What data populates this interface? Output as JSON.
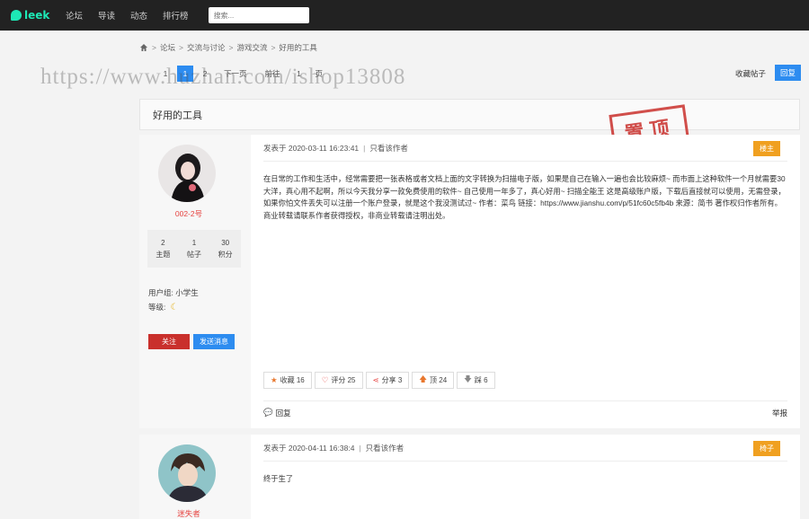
{
  "logo": {
    "text": "leek"
  },
  "nav": {
    "items": [
      "论坛",
      "导读",
      "动态",
      "排行榜"
    ],
    "search_placeholder": "搜索..."
  },
  "breadcrumb": [
    "论坛",
    "交流与讨论",
    "游戏交流",
    "好用的工具"
  ],
  "pager": {
    "items": [
      "1",
      "2",
      "下一页",
      "前往",
      "1",
      "页"
    ],
    "active": "1"
  },
  "toolbar": {
    "favorite": "收藏帖子",
    "reply": "回复"
  },
  "watermark": "https://www.huzhan.com/ishop13808",
  "thread": {
    "title": "好用的工具",
    "stamp": "置顶"
  },
  "posts": [
    {
      "author": "002-2号",
      "stats": [
        {
          "value": "2",
          "label": "主题"
        },
        {
          "value": "1",
          "label": "帖子"
        },
        {
          "value": "30",
          "label": "积分"
        }
      ],
      "group": "用户组: 小学生",
      "level_label": "等级:",
      "follow": "关注",
      "message": "发送消息",
      "posted": "发表于 2020-03-11 16:23:41",
      "view_author": "只看该作者",
      "floor": "楼主",
      "content": "在日常的工作和生活中，经常需要把一张表格或者文档上面的文字转换为扫描电子版，如果是自己在输入一遍也会比较麻烦~ 而市面上这种软件一个月就需要30大洋，真心用不起啊，所以今天我分享一款免费使用的软件~ 自己使用一年多了，真心好用~ 扫描全能王 这是高级账户版，下载后直接就可以使用，无需登录，如果你怕文件丢失可以注册一个账户登录，就是这个我没测试过~ 作者：菜鸟 链接：https://www.jianshu.com/p/51fc60c5fb4b 来源：简书 著作权归作者所有。商业转载请联系作者获得授权，非商业转载请注明出处。",
      "actions": [
        {
          "icon": "star-icon",
          "label": "收藏 16"
        },
        {
          "icon": "thumb-icon",
          "label": "评分 25"
        },
        {
          "icon": "share-icon",
          "label": "分享 3"
        },
        {
          "icon": "up-icon",
          "label": "顶 24"
        },
        {
          "icon": "down-icon",
          "label": "踩 6"
        }
      ],
      "reply": "回复",
      "report": "举报"
    },
    {
      "author": "迷失者",
      "posted": "发表于 2020-04-11 16:38:4",
      "view_author": "只看该作者",
      "floor": "椅子",
      "content": "终于生了"
    }
  ],
  "colors": {
    "accent": "#2d8cf0",
    "danger": "#c9302c",
    "badge": "#f0a020",
    "logo": "#1de9b6"
  }
}
